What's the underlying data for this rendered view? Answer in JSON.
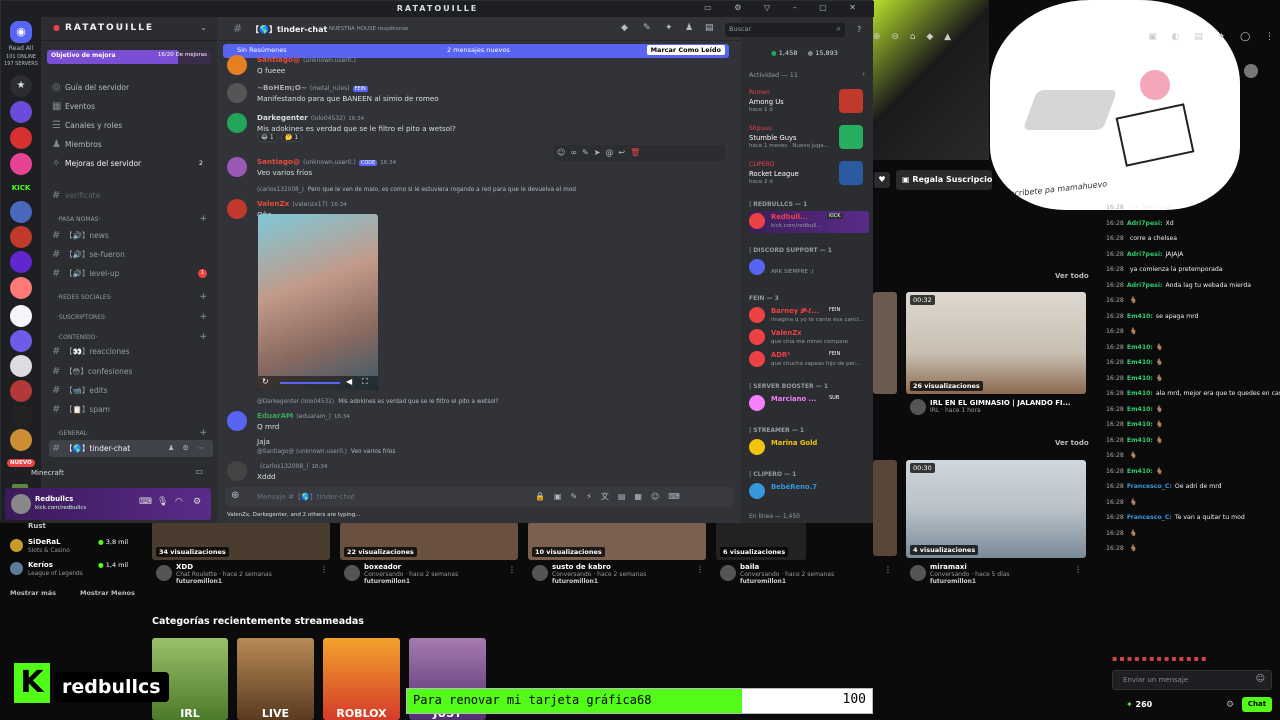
{
  "discord": {
    "window_title": "RATATOUILLE",
    "server_name": "RATATOUILLE",
    "left_rail": {
      "read_all": "Read All",
      "online": "101 ONLINE",
      "servers": "197 SERVERS",
      "new_badge": "NUEVO"
    },
    "goal": {
      "label": "Objetivo de mejora",
      "progress": "16/20 De mejoras",
      "fraction": 0.8
    },
    "nav": [
      {
        "label": "Guía del servidor",
        "icon": "compass-icon"
      },
      {
        "label": "Eventos",
        "icon": "calendar-icon"
      },
      {
        "label": "Canales y roles",
        "icon": "list-icon"
      },
      {
        "label": "Miembros",
        "icon": "members-icon"
      },
      {
        "label": "Mejoras del servidor",
        "icon": "boost-icon",
        "badge": "2"
      }
    ],
    "channels": [
      {
        "label": "verificate",
        "type": "channel"
      },
      {
        "label": "·PASA NOMAS·",
        "type": "category"
      },
      {
        "label": "【🔊】news",
        "type": "channel"
      },
      {
        "label": "【🔊】se-fueron",
        "type": "channel"
      },
      {
        "label": "【🔊】level-up",
        "type": "channel",
        "badge": "1"
      },
      {
        "label": "·REDES SOCIALES·",
        "type": "category"
      },
      {
        "label": "·SUSCRIPTORES·",
        "type": "category"
      },
      {
        "label": "·CONTENIDO·",
        "type": "category"
      },
      {
        "label": "【👀】reacciones",
        "type": "channel"
      },
      {
        "label": "【😳】confesiones",
        "type": "channel"
      },
      {
        "label": "【📹】edits",
        "type": "channel"
      },
      {
        "label": "【📋】spam",
        "type": "channel"
      },
      {
        "label": "·GENERAL·",
        "type": "category"
      },
      {
        "label": "【🌎】tinder-chat",
        "type": "channel",
        "active": true
      }
    ],
    "voice_server": "Minecraft",
    "user_panel": {
      "name": "Redbullcs",
      "status": "kick.com/redbullcs"
    },
    "header": {
      "channel": "【🌎】tinder-chat",
      "topic": "NUESTRA HOUSE respētense",
      "search_placeholder": "Buscar"
    },
    "new_messages_bar": {
      "left": "Sin Resúmenes",
      "center": "2 mensajes nuevos",
      "right": "Marcar Como Leído"
    },
    "messages": [
      {
        "name": "Santiago@",
        "tag": "(unknown.user0.)",
        "text": "Q fueee",
        "color": "#e74c3c"
      },
      {
        "name": "~BoHEm;O~",
        "tag": "(metal_rules)",
        "badge": "FEIN",
        "text": "Manifestando para que BANEEN al simio de romeo",
        "color": "#aaaaaa"
      },
      {
        "name": "Darkegenter",
        "tag": "(lolo04532)",
        "time": "16:34",
        "text": "Mis adokines es verdad que se le filtro el pito a wetsol?",
        "color": "#dbdee1"
      },
      {
        "name": "Santiago@",
        "tag": "(unknown.user0.)",
        "badge": "CODE",
        "time": "16:34",
        "text": "Veo varios fríos",
        "color": "#e74c3c"
      },
      {
        "reply": "Pero que le ven de malo, es como si le estuviera rogando a red para que le devuelva el mod",
        "reply_user": "(carlos132008_)",
        "name": "ValenZx",
        "tag": "(valenzx17)",
        "time": "16:34",
        "text": "Oño",
        "color": "#e74c3c"
      },
      {
        "reply": "Mis adokines es verdad que se le filtro el pito a wetsol?",
        "reply_user": "@Darkegenter (lolo04532)",
        "name": "EduarAM",
        "tag": "(eduaram_)",
        "time": "16:34",
        "text": "Q mrd",
        "text2": "Jaja",
        "color": "#3ba55d"
      },
      {
        "reply": "Veo varios fríos",
        "reply_user": "@Santiago@ (unknown.user0.)",
        "name": "",
        "tag": "(carlos132008_)",
        "time": "16:34",
        "text": "Xddd",
        "color": "#e74c3c"
      }
    ],
    "reactions": [
      "😂 1",
      "🤔 1"
    ],
    "composer": {
      "placeholder": "Mensaje #【🌎】tinder-chat",
      "typing": "ValenZx, Darkegenter, and 2 others are typing..."
    },
    "members": {
      "stats": {
        "online": "1,458",
        "total": "15,893"
      },
      "activity_header": "Actividad — 11",
      "activities": [
        {
          "user": "Romeo",
          "game": "Among Us",
          "time": "hace 1 d",
          "icon_color": "#c0392b"
        },
        {
          "user": "Shpuuu",
          "game": "Stumble Guys",
          "time": "hace 1 meses · Nuevo juga...",
          "icon_color": "#27ae60"
        },
        {
          "user": "CLIPERO",
          "game": "Rocket League",
          "time": "hace 2 d",
          "icon_color": "#2c5aa0"
        }
      ],
      "groups": [
        {
          "title": "| REDBULLCS — 1",
          "members": [
            {
              "name": "Redbull...",
              "status": "kick.com/redbull...",
              "color": "#ed4245",
              "badge": "KICK"
            }
          ]
        },
        {
          "title": "| DISCORD SUPPORT — 1",
          "members": [
            {
              "name": "",
              "status": "ARK SIEMPRE :)",
              "color": "#5865f2"
            }
          ]
        },
        {
          "title": "FEIN — 3",
          "members": [
            {
              "name": "Barney 𝓟-ℓ...",
              "status": "imagina q yo te cante esa canci...",
              "color": "#ed4245",
              "badge": "FEIN"
            },
            {
              "name": "ValenZx",
              "status": "que chia me miras compare",
              "color": "#ed4245"
            },
            {
              "name": "ADR²",
              "status": "que chucha sapeas hijo de per...",
              "color": "#ed4245",
              "badge": "FEIN"
            }
          ]
        },
        {
          "title": "| SERVER BOOSTER — 1",
          "members": [
            {
              "name": "Marciano ...",
              "status": "",
              "color": "#f47fff",
              "badge": "SUB"
            }
          ]
        },
        {
          "title": "| STREAMER — 1",
          "members": [
            {
              "name": "Marina Gold",
              "status": "",
              "color": "#f1c40f"
            }
          ]
        },
        {
          "title": "| CLIPERO — 1",
          "members": [
            {
              "name": "BebéReno.7",
              "status": "",
              "color": "#3498db"
            }
          ]
        }
      ],
      "online_footer": "En línea — 1,450"
    }
  },
  "kick": {
    "gift_label": "Regala Suscripcio",
    "see_all": "Ver todo",
    "sidebar": [
      {
        "name": "Rust",
        "game": "",
        "count": ""
      },
      {
        "name": "SiDeRaL",
        "game": "Slots & Casino",
        "count": "3,8 mil"
      },
      {
        "name": "Keríos",
        "game": "League of Legends",
        "count": "1,4 mil"
      }
    ],
    "show_more": "Mostrar más",
    "show_less": "Mostrar Menos",
    "clips": [
      {
        "views": "34 visualizaciones",
        "title": "XDD",
        "sub": "Chat Roulette · hace 2 semanas",
        "user": "futuromillon1"
      },
      {
        "views": "22 visualizaciones",
        "title": "boxeador",
        "sub": "Conversando · hace 2 semanas",
        "user": "futuromillon1"
      },
      {
        "views": "10 visualizaciones",
        "title": "susto de kabro",
        "sub": "Conversando · hace 2 semanas",
        "user": "futuromillon1"
      },
      {
        "views": "6 visualizaciones",
        "title": "baila",
        "sub": "Conversando · hace 2 semanas",
        "user": "futuromillon1"
      },
      {
        "views": "4 visualizaciones",
        "title": "miramaxi",
        "sub": "Conversando · hace 5 días",
        "user": "futuromillon1",
        "duration": "00:30"
      }
    ],
    "top_clip": {
      "views": "26 visualizaciones",
      "duration": "00:32",
      "title": "IRL EN EL GIMNASIO | JALANDO FI...",
      "sub": "IRL · hace 1 hora"
    },
    "recent_categories_title": "Categorías recientemente streameadas",
    "categories": [
      "IRL",
      "LIVE",
      "ROBLOX",
      "JUST"
    ],
    "chat": [
      {
        "time": "16:28",
        "user": "",
        "text": "me hice caca",
        "color": "#e74c3c"
      },
      {
        "time": "16:28",
        "user": "Adri7pesi:",
        "text": "Xd",
        "color": "#2ecc71"
      },
      {
        "time": "16:28",
        "user": "",
        "text": "corre a chelsea",
        "color": "#e74c3c"
      },
      {
        "time": "16:28",
        "user": "Adri7pesi:",
        "text": "JAJAJA",
        "color": "#2ecc71"
      },
      {
        "time": "16:28",
        "user": "",
        "text": "ya comienza la pretemporada",
        "color": "#e74c3c"
      },
      {
        "time": "16:28",
        "user": "Adri7pesi:",
        "text": "Anda lag tu webada mierda",
        "color": "#2ecc71"
      },
      {
        "time": "16:28",
        "user": "",
        "text": "🫰🏽",
        "color": "#e74c3c"
      },
      {
        "time": "16:28",
        "user": "Em410:",
        "text": "se apaga mrd",
        "color": "#2ecc71"
      },
      {
        "time": "16:28",
        "user": "",
        "text": "🫰🏽",
        "color": "#e74c3c"
      },
      {
        "time": "16:28",
        "user": "Em410:",
        "text": "🫰🏽",
        "color": "#2ecc71"
      },
      {
        "time": "16:28",
        "user": "Em410:",
        "text": "🫰🏽",
        "color": "#2ecc71"
      },
      {
        "time": "16:28",
        "user": "Em410:",
        "text": "🫰🏽",
        "color": "#2ecc71"
      },
      {
        "time": "16:28",
        "user": "Em410:",
        "text": "ala mrd, mejor era que te quedes en casa",
        "color": "#2ecc71"
      },
      {
        "time": "16:28",
        "user": "Em410:",
        "text": "🫰🏽",
        "color": "#2ecc71"
      },
      {
        "time": "16:28",
        "user": "Em410:",
        "text": "🫰🏽",
        "color": "#2ecc71"
      },
      {
        "time": "16:28",
        "user": "Em410:",
        "text": "🫰🏽",
        "color": "#2ecc71"
      },
      {
        "time": "16:28",
        "user": "",
        "text": "🫰🏽",
        "color": "#e74c3c"
      },
      {
        "time": "16:28",
        "user": "Em410:",
        "text": "🫰🏽",
        "color": "#2ecc71"
      },
      {
        "time": "16:28",
        "user": "Francesco_C:",
        "text": "Oe adri de mrd",
        "color": "#3498db"
      },
      {
        "time": "16:28",
        "user": "",
        "text": "🫰🏽",
        "color": "#e74c3c"
      },
      {
        "time": "16:28",
        "user": "Francesco_C:",
        "text": "Te van a quitar tu mod",
        "color": "#3498db"
      },
      {
        "time": "16:28",
        "user": "",
        "text": "🫰🏽",
        "color": "#e74c3c"
      },
      {
        "time": "16:28",
        "user": "",
        "text": "🫰🏽",
        "color": "#e74c3c"
      }
    ],
    "chat_input_placeholder": "Enviar un mensaje",
    "points": "260",
    "chat_button": "Chat",
    "overlay_text": "Suscribete pa mamahuevo",
    "brand": "redbullcs"
  },
  "goal_bar": {
    "text": "Para renovar mi tarjeta gráfica68",
    "value": "100",
    "fraction": 0.72
  }
}
